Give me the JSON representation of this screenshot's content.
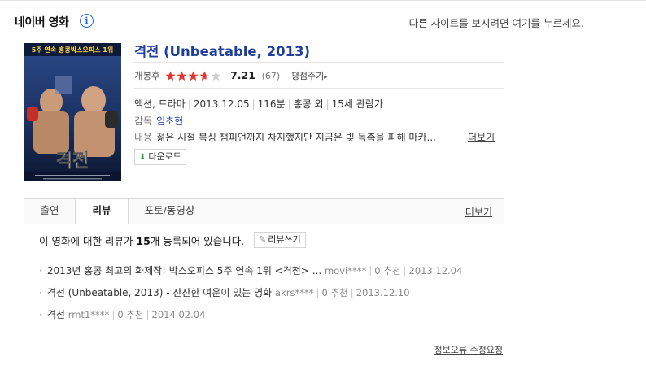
{
  "header": {
    "brand": "네이버 영화",
    "info_icon": "i",
    "redirect_prefix": "다른 사이트를 보시려면 ",
    "redirect_link": "여기",
    "redirect_suffix": "를 누르세요."
  },
  "movie": {
    "title": "격전 (Unbeatable, 2013)",
    "poster_banner": "5주 연속 홍콩박스오피스 1위",
    "poster_title": "격전",
    "rating_label": "개봉후",
    "rating_score": "7.21",
    "rating_fraction": 0.72,
    "rating_count": "(67)",
    "rate_link": "평점주기",
    "genre": "액션, 드라마",
    "release_date": "2013.12.05",
    "runtime": "116분",
    "country": "홍콩 외",
    "age_rating": "15세 관람가",
    "director_label": "감독",
    "director": "임초현",
    "synopsis_label": "내용",
    "synopsis": "젊은 시절 복싱 챔피언까지 차지했지만 지금은 빚 독촉을 피해 마카...",
    "more_label": "더보기",
    "download_label": "다운로드"
  },
  "tabs": {
    "items": [
      "출연",
      "리뷰",
      "포토/동영상"
    ],
    "active": "리뷰",
    "more_label": "더보기"
  },
  "reviews": {
    "summary_prefix": "이 영화에 대한 리뷰가 ",
    "count": "15",
    "summary_suffix": "개 등록되어 있습니다.",
    "write_label": "리뷰쓰기",
    "items": [
      {
        "title": "2013년 홍콩 최고의 화제작! 박스오피스 5주 연속 1위 <격전> ...",
        "author": "movi****",
        "recommend": "0 추천",
        "date": "2013.12.04"
      },
      {
        "title": "격전 (Unbeatable, 2013) - 잔잔한 여운이 있는 영화",
        "author": "akrs****",
        "recommend": "0 추천",
        "date": "2013.12.10"
      },
      {
        "title": "격전",
        "author": "rmt1****",
        "recommend": "0 추천",
        "date": "2014.02.04"
      }
    ]
  },
  "footer": {
    "report_link": "정보오류 수정요청"
  },
  "colors": {
    "title_blue": "#1f3f9a",
    "star_red": "#e3342f",
    "star_grey": "#cfcfcf",
    "download_green": "#2e9a2e"
  }
}
